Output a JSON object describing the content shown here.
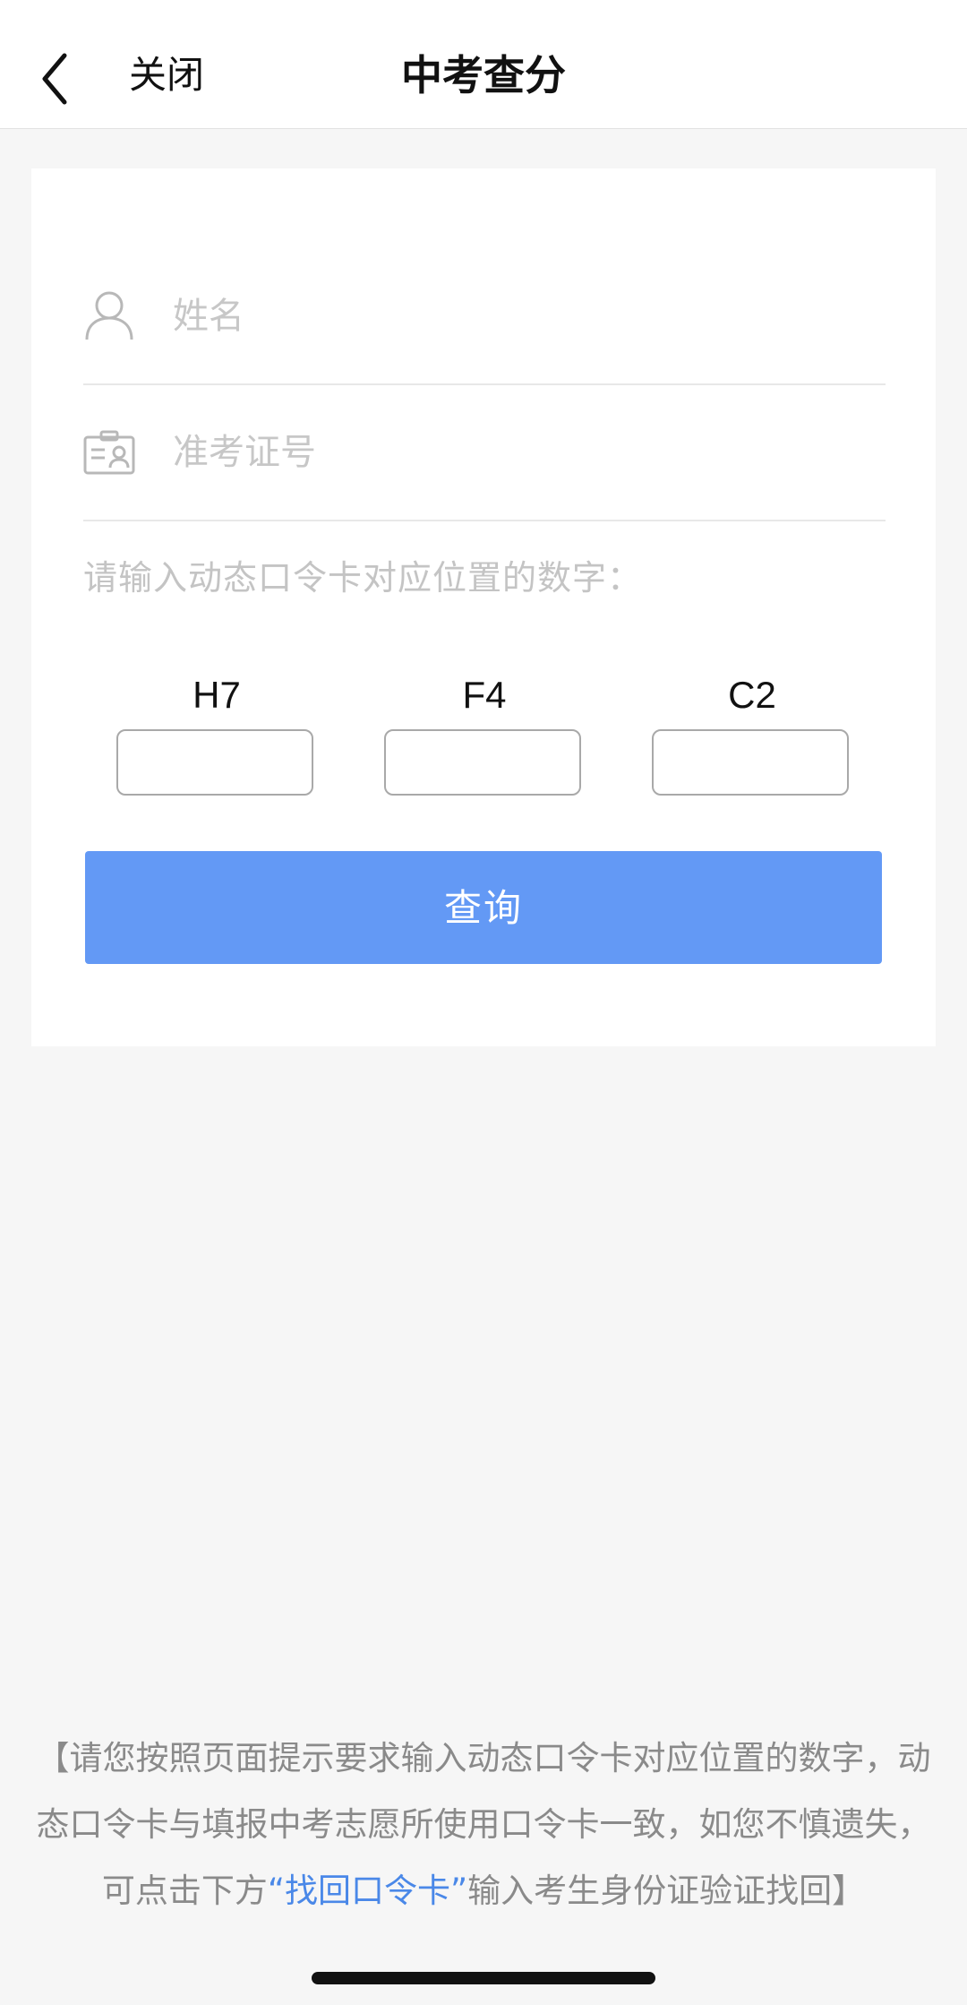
{
  "nav": {
    "back_icon": "chevron-left-icon",
    "close_label": "关闭",
    "title": "中考查分"
  },
  "form": {
    "name_icon": "person-icon",
    "name_placeholder": "姓名",
    "name_value": "",
    "exam_icon": "id-card-icon",
    "exam_placeholder": "准考证号",
    "exam_value": "",
    "hint": "请输入动态口令卡对应位置的数字：",
    "codes": [
      {
        "label": "H7",
        "value": ""
      },
      {
        "label": "F4",
        "value": ""
      },
      {
        "label": "C2",
        "value": ""
      }
    ],
    "query_label": "查询"
  },
  "notice": {
    "prefix": "【请您按照页面提示要求输入动态口令卡对应位置的数字，动态口令卡与填报中考志愿所使用口令卡一致，如您不慎遗失，可点击下方",
    "link": "“找回口令卡”",
    "suffix": "输入考生身份证验证找回】"
  },
  "colors": {
    "accent": "#6399f5",
    "link": "#4a88e8",
    "background": "#f6f6f6"
  }
}
